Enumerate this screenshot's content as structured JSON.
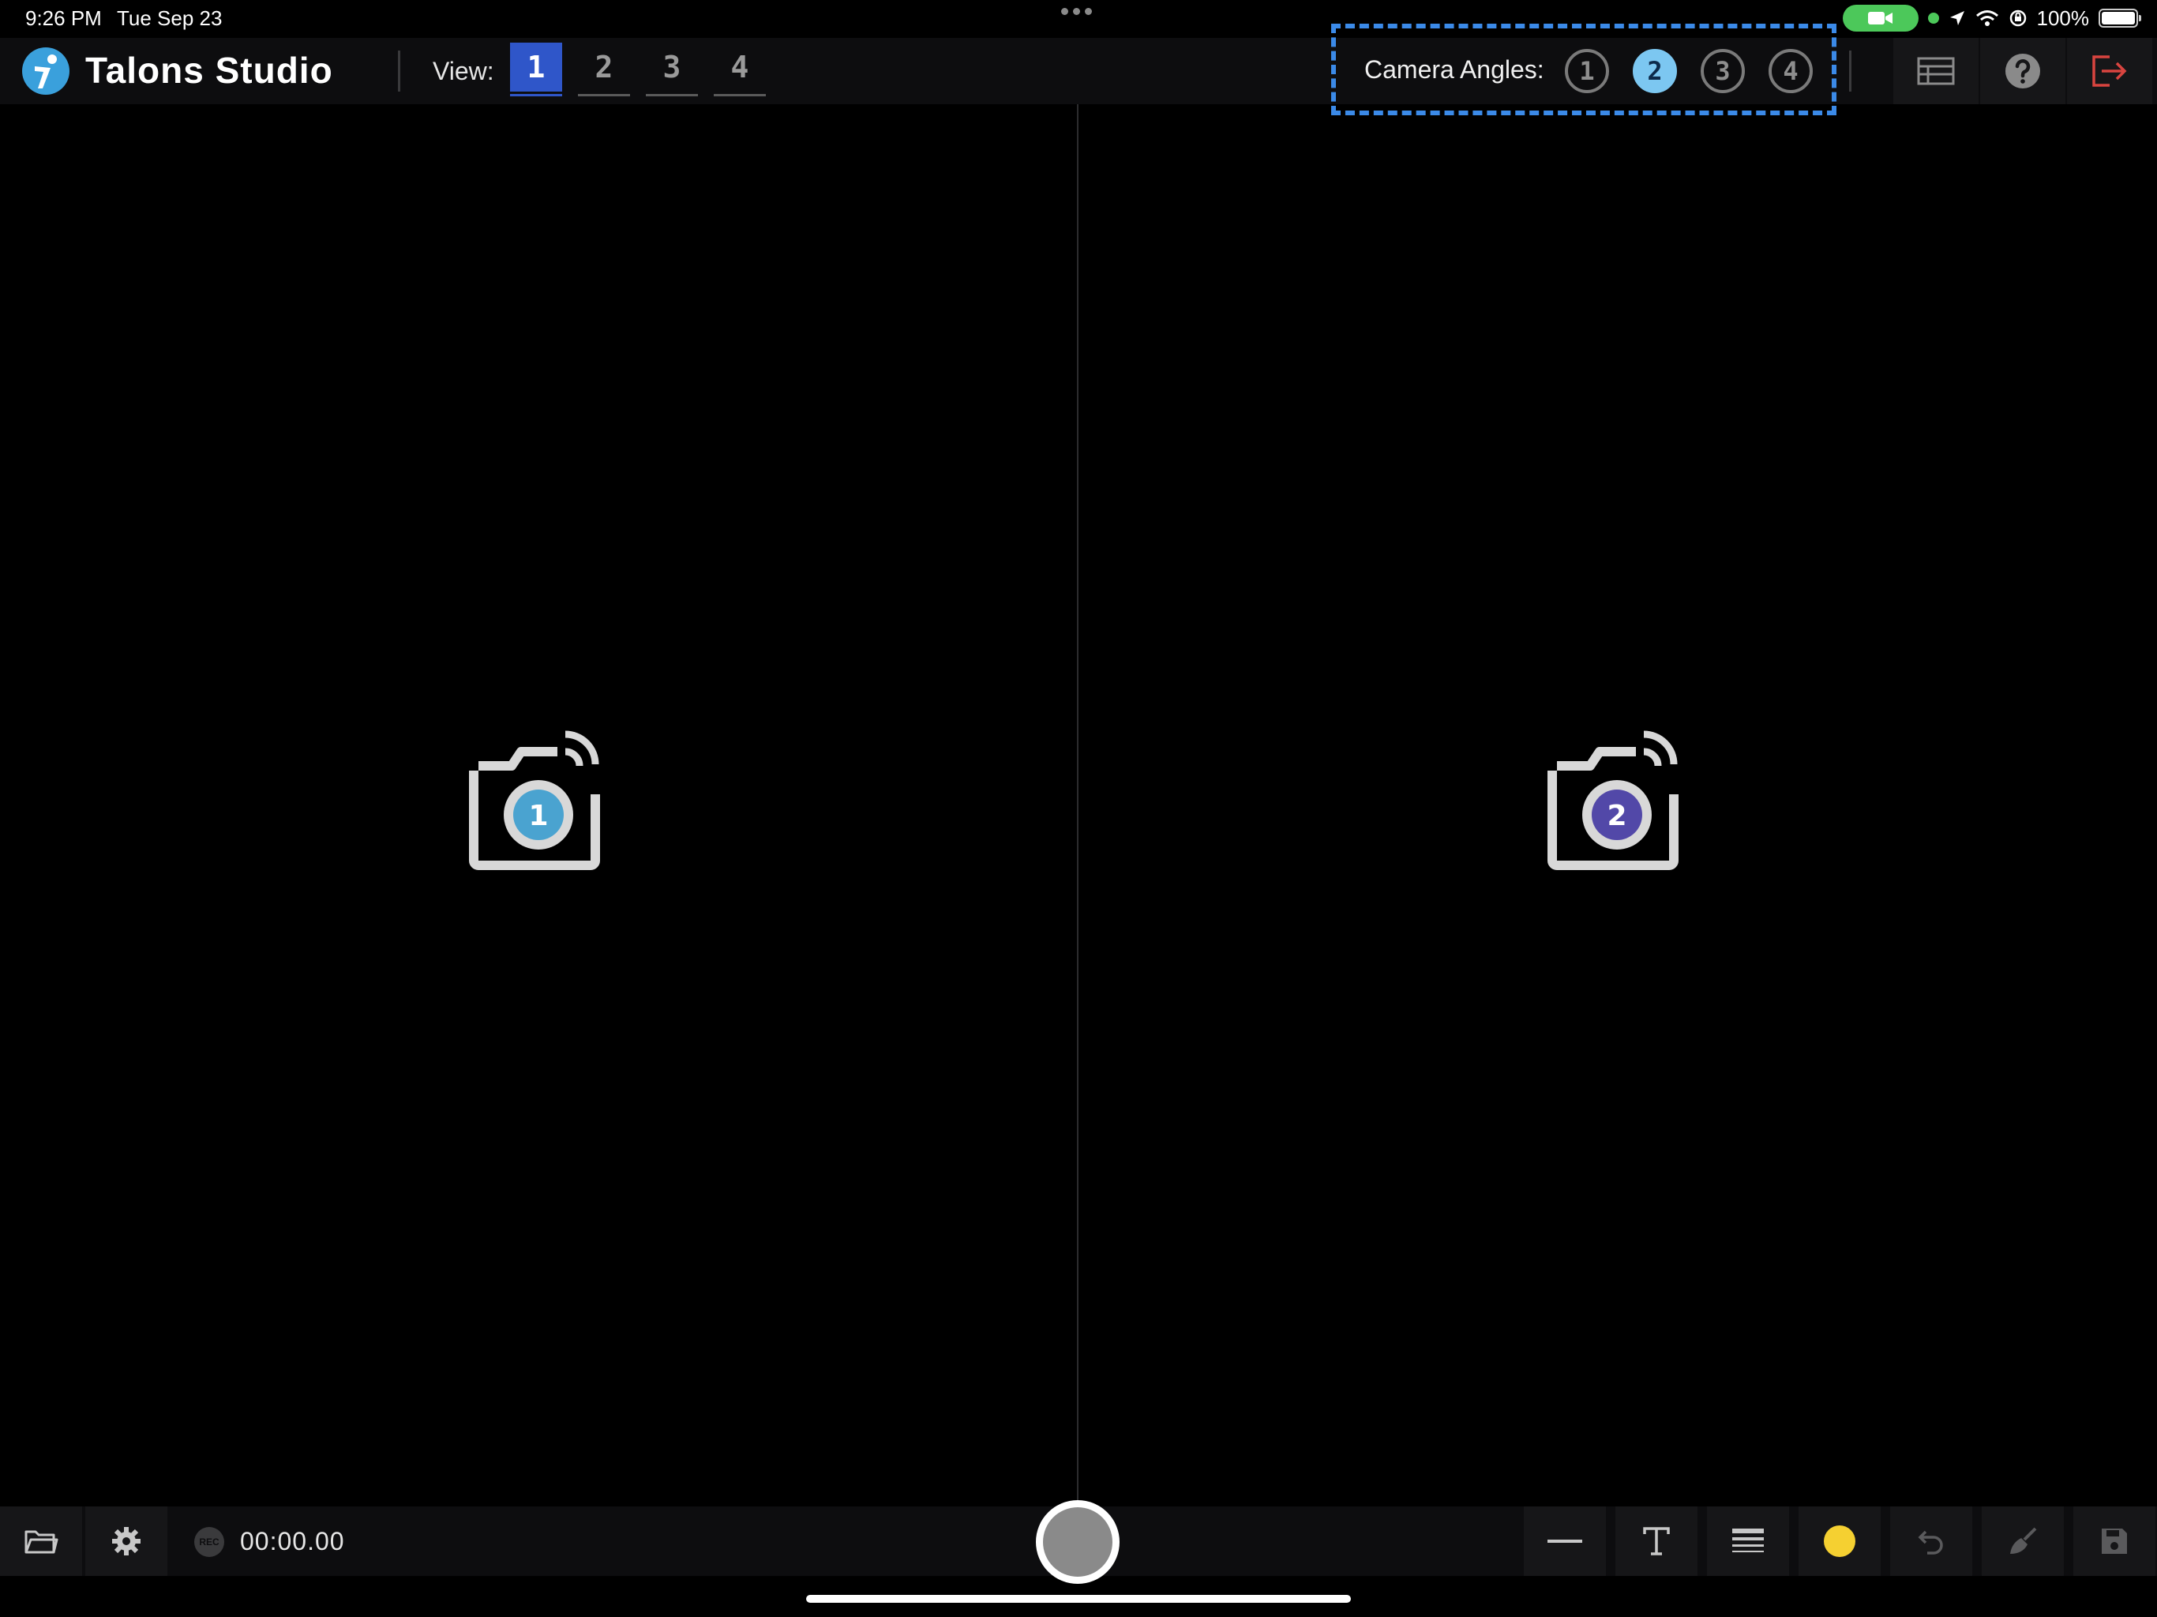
{
  "status_bar": {
    "time": "9:26 PM",
    "date": "Tue Sep 23",
    "battery_percent": "100%",
    "battery_level": 1.0,
    "icons": [
      "camera-in-use-icon",
      "location-icon",
      "wifi-icon",
      "screen-lock-rotation-icon",
      "battery-icon"
    ]
  },
  "header": {
    "app_title": "Talons Studio",
    "view_label": "View:",
    "views": [
      {
        "label": "1",
        "active": true
      },
      {
        "label": "2",
        "active": false
      },
      {
        "label": "3",
        "active": false
      },
      {
        "label": "4",
        "active": false
      }
    ],
    "camera_angles_label": "Camera Angles:",
    "camera_angles": [
      {
        "label": "1",
        "active": false
      },
      {
        "label": "2",
        "active": true
      },
      {
        "label": "3",
        "active": false
      },
      {
        "label": "4",
        "active": false
      }
    ],
    "tools": [
      "list-view-icon",
      "help-icon",
      "logout-icon"
    ]
  },
  "feeds": [
    {
      "camera_number": "1",
      "badge_color": "#4aa3d0"
    },
    {
      "camera_number": "2",
      "badge_color": "#5248a8"
    }
  ],
  "bottom_bar": {
    "rec_badge": "REC",
    "timer": "00:00.00",
    "tools": [
      "folder-icon",
      "settings-icon",
      "line-tool-icon",
      "text-tool-icon",
      "line-weight-icon",
      "color-picker-icon",
      "undo-icon",
      "clear-icon",
      "save-icon"
    ],
    "selected_color": "#f5d031"
  },
  "colors": {
    "accent_blue": "#2f56c9",
    "dashed_highlight": "#3b8ae8",
    "active_angle": "#7cc7f1",
    "logout_red": "#d9443f"
  }
}
